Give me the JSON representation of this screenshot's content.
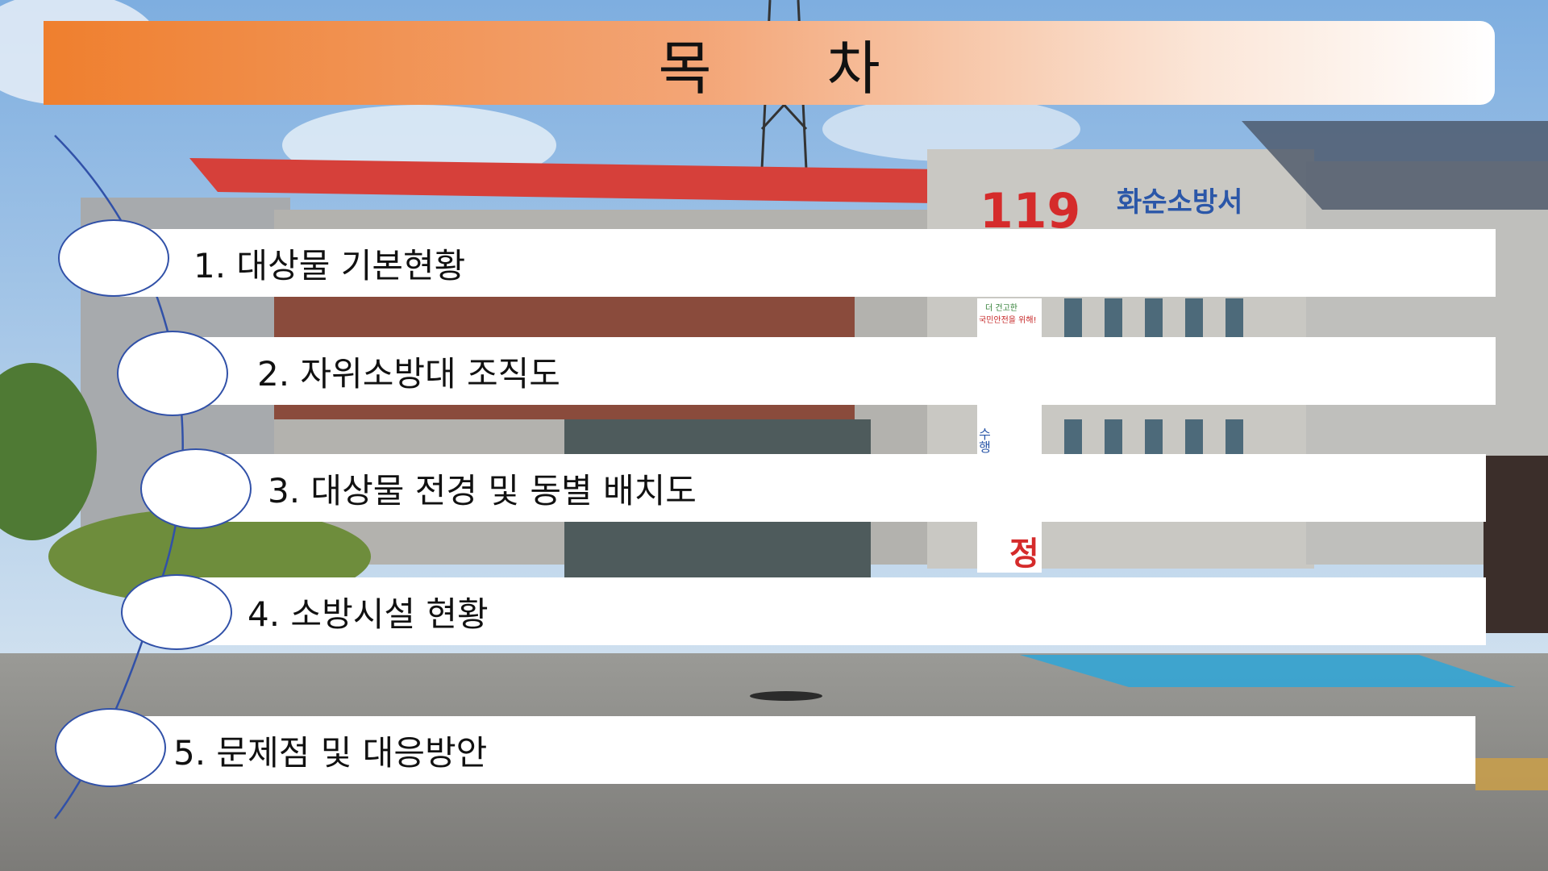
{
  "slide": {
    "title": "목  차",
    "items": [
      {
        "label": "1. 대상물 기본현황"
      },
      {
        "label": "2. 자위소방대 조직도"
      },
      {
        "label": "3. 대상물 전경 및 동별 배치도"
      },
      {
        "label": "4. 소방시설 현황"
      },
      {
        "label": "5. 문제점 및 대응방안"
      }
    ]
  },
  "background": {
    "sign_number": "119",
    "sign_text": "화순소방서",
    "banner_vertical": "수행소",
    "banner_right": "정",
    "banner_top_small": "더 건고한",
    "banner_top_small2": "국민안전을 위해!"
  },
  "colors": {
    "title_start": "#ef7f2e",
    "title_end": "#ffffff",
    "sky": "#8fb6e0",
    "ground": "#8a8a86",
    "roof_red": "#d6403a",
    "curve": "#3151a8"
  }
}
